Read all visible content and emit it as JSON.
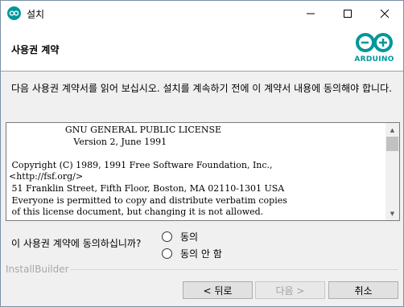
{
  "window": {
    "title": "설치",
    "minimize_icon": "minimize-icon",
    "maximize_icon": "maximize-icon",
    "close_icon": "close-icon"
  },
  "header": {
    "title": "사용권 계약",
    "logo_text": "ARDUINO",
    "logo_color": "#00979c"
  },
  "description": "다음 사용권 계약서를 읽어 보십시오. 설치를 계속하기 전에 이 계약서 내용에 동의해야 합니다.",
  "license": {
    "lines": [
      "                    GNU GENERAL PUBLIC LICENSE",
      "                       Version 2, June 1991",
      "",
      " Copyright (C) 1989, 1991 Free Software Foundation, Inc.,",
      "<http://fsf.org/>",
      " 51 Franklin Street, Fifth Floor, Boston, MA 02110-1301 USA",
      " Everyone is permitted to copy and distribute verbatim copies",
      " of this license document, but changing it is not allowed."
    ]
  },
  "agreement": {
    "question": "이 사용권 계약에 동의하십니까?",
    "options": [
      "동의",
      "동의 안 함"
    ]
  },
  "footer": {
    "brand": "InstallBuilder",
    "back_label": "< 뒤로",
    "next_label": "다음 >",
    "cancel_label": "취소"
  }
}
